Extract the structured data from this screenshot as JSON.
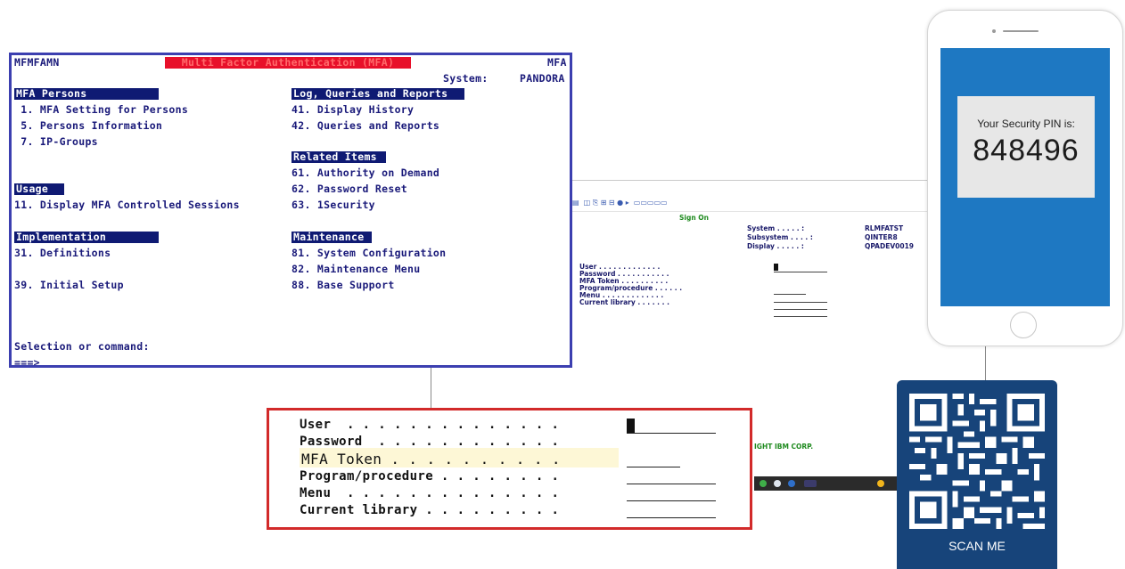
{
  "mfa_screen": {
    "program_id": "MFMFAMN",
    "title": "Multi Factor Authentication (MFA)",
    "product": "MFA",
    "system_label": "System:",
    "system_value": "PANDORA",
    "sections": {
      "persons": "MFA Persons",
      "log": "Log, Queries and Reports",
      "related": "Related Items",
      "usage": "Usage",
      "implementation": "Implementation",
      "maintenance": "Maintenance"
    },
    "items": {
      "i1": " 1. MFA Setting for Persons",
      "i5": " 5. Persons Information",
      "i7": " 7. IP-Groups",
      "i41": "41. Display History",
      "i42": "42. Queries and Reports",
      "i61": "61. Authority on Demand",
      "i62": "62. Password Reset",
      "i63": "63. 1Security",
      "i11": "11. Display MFA Controlled Sessions",
      "i31": "31. Definitions",
      "i39": "39. Initial Setup",
      "i81": "81. System Configuration",
      "i82": "82. Maintenance Menu",
      "i88": "88. Base Support"
    },
    "selection_prompt": "Selection or command:",
    "command_prompt": "===>"
  },
  "signon_window": {
    "title": "Sign On",
    "system_label": "System . . . . . :",
    "system_value": "RLMFATST",
    "subsystem_label": "Subsystem . . . . :",
    "subsystem_value": "QINTER8",
    "display_label": "Display . . . . . :",
    "display_value": "QPADEV0019",
    "fields": [
      "User . . . . . . . . . . . . .",
      "Password . . . . . . . . . . .",
      "MFA Token . . . . . . . . . .",
      "Program/procedure . . . . . .",
      "Menu . . . . . . . . . . . . .",
      "Current library . . . . . . ."
    ],
    "copyright": "IGHT IBM CORP."
  },
  "zoom_box": {
    "fields": [
      "User  . . . . . . . . . . . . . .",
      "Password  . . . . . . . . . . . .",
      "MFA Token . . . . . . . . . .",
      "Program/procedure . . . . . . . .",
      "Menu  . . . . . . . . . . . . . .",
      "Current library . . . . . . . . ."
    ]
  },
  "phone": {
    "pin_label": "Your Security PIN is:",
    "pin_value": "848496"
  },
  "qr": {
    "label": "SCAN ME"
  },
  "colors": {
    "screen_border": "#3c3fb0",
    "section_bg": "#0f1a73",
    "title_bar": "#e8102a",
    "zoom_border": "#d22a2a",
    "phone_screen": "#1e78c2",
    "qr_card": "#17447a"
  }
}
